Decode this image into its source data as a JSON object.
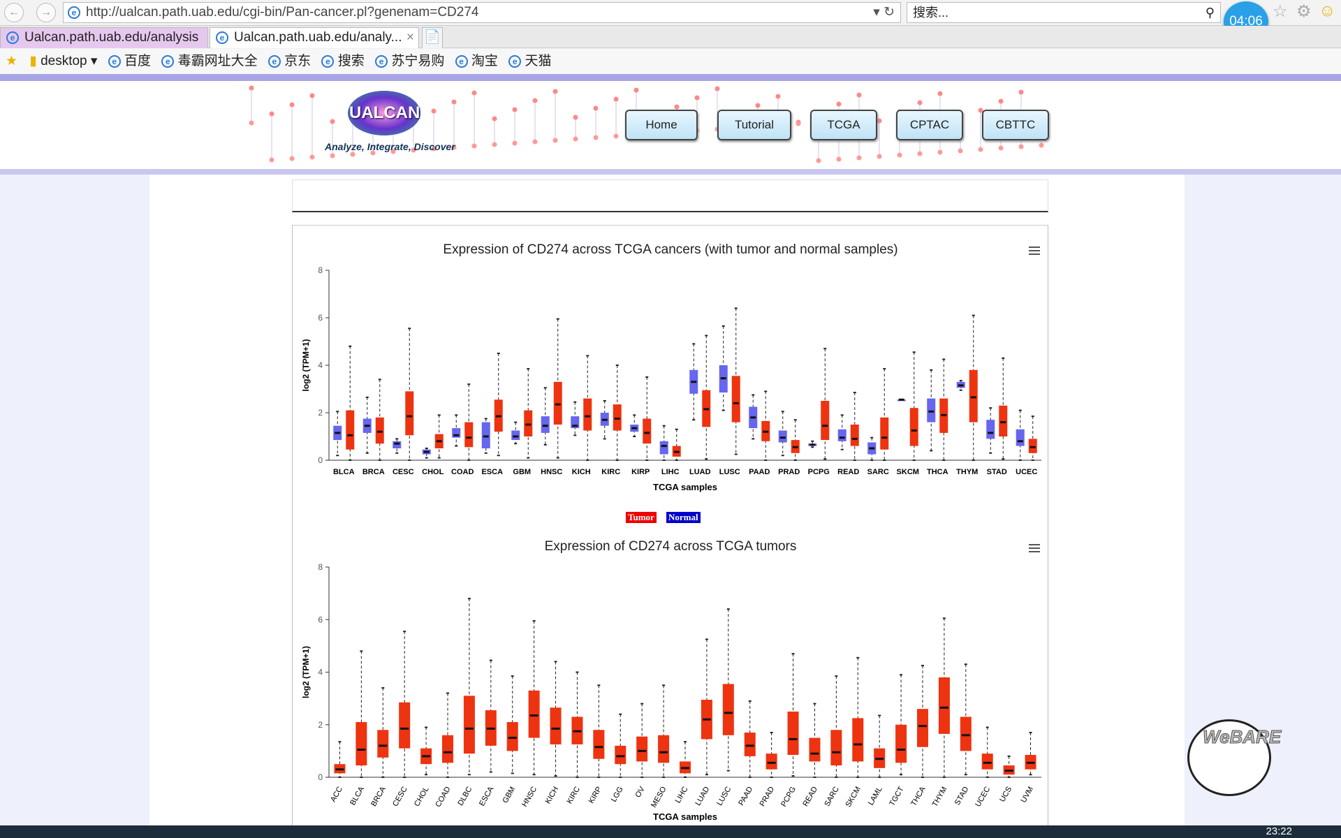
{
  "browser": {
    "url": "http://ualcan.path.uab.edu/cgi-bin/Pan-cancer.pl?genenam=CD274",
    "search_placeholder": "搜索...",
    "clock": "04:06",
    "tabs": [
      {
        "label": "Ualcan.path.uab.edu/analysis"
      },
      {
        "label": "Ualcan.path.uab.edu/analy..."
      }
    ],
    "bookmarks": [
      "desktop",
      "百度",
      "毒霸网址大全",
      "京东",
      "搜索",
      "苏宁易购",
      "淘宝",
      "天猫"
    ],
    "taskbar_time": "23:22"
  },
  "header": {
    "logo": "UALCAN",
    "tagline": "Analyze, Integrate, Discover",
    "nav": [
      "Home",
      "Tutorial",
      "TCGA",
      "CPTAC",
      "CBTTC"
    ]
  },
  "legend": {
    "tumor": "Tumor",
    "normal": "Normal"
  },
  "colors": {
    "tumor": "#ee3311",
    "normal": "#6666ee",
    "accent": "#2aa0e8"
  },
  "chart_data": [
    {
      "type": "box",
      "title": "Expression of CD274 across TCGA cancers (with tumor and normal samples)",
      "xlabel": "TCGA samples",
      "ylabel": "log2 (TPM+1)",
      "ylim": [
        0,
        8
      ],
      "yticks": [
        0,
        2,
        4,
        6,
        8
      ],
      "grid": false,
      "categories": [
        "BLCA",
        "BRCA",
        "CESC",
        "CHOL",
        "COAD",
        "ESCA",
        "GBM",
        "HNSC",
        "KICH",
        "KIRC",
        "KIRP",
        "LIHC",
        "LUAD",
        "LUSC",
        "PAAD",
        "PRAD",
        "PCPG",
        "READ",
        "SARC",
        "SKCM",
        "THCA",
        "THYM",
        "STAD",
        "UCEC"
      ],
      "stat_order": [
        "min",
        "q1",
        "median",
        "q3",
        "max"
      ],
      "series": [
        {
          "name": "Normal",
          "color": "#6666ee",
          "values": [
            [
              0.2,
              0.85,
              1.15,
              1.45,
              2.05
            ],
            [
              0.3,
              1.15,
              1.45,
              1.75,
              2.65
            ],
            [
              0.3,
              0.5,
              0.7,
              0.8,
              0.9
            ],
            [
              0.1,
              0.25,
              0.35,
              0.45,
              0.5
            ],
            [
              0.6,
              0.95,
              1.05,
              1.35,
              1.9
            ],
            [
              0.3,
              0.5,
              1.0,
              1.6,
              1.75
            ],
            [
              0.7,
              0.85,
              1.0,
              1.25,
              1.6
            ],
            [
              0.65,
              1.15,
              1.45,
              1.85,
              3.05
            ],
            [
              1.05,
              1.35,
              1.45,
              1.85,
              2.45
            ],
            [
              0.9,
              1.45,
              1.7,
              2.0,
              2.5
            ],
            [
              1.0,
              1.2,
              1.35,
              1.5,
              1.9
            ],
            [
              0,
              0.25,
              0.6,
              0.8,
              1.45
            ],
            [
              1.7,
              2.8,
              3.3,
              3.8,
              4.9
            ],
            [
              2.1,
              2.85,
              3.45,
              4.0,
              5.65
            ],
            [
              0.9,
              1.35,
              1.8,
              2.25,
              2.75
            ],
            [
              0.2,
              0.75,
              0.95,
              1.25,
              2.05
            ],
            [
              0.55,
              0.6,
              0.65,
              0.7,
              0.8
            ],
            [
              0.45,
              0.8,
              0.95,
              1.3,
              1.9
            ],
            [
              0,
              0.25,
              0.5,
              0.75,
              0.95
            ],
            [
              2.55,
              2.55,
              2.55,
              2.55,
              2.55
            ],
            [
              0.4,
              1.6,
              2.05,
              2.6,
              3.8
            ],
            [
              2.95,
              3.05,
              3.15,
              3.3,
              3.35
            ],
            [
              0.3,
              0.9,
              1.15,
              1.7,
              2.2
            ],
            [
              0,
              0.6,
              0.8,
              1.3,
              2.1
            ]
          ]
        },
        {
          "name": "Tumor",
          "color": "#ee3311",
          "values": [
            [
              0,
              0.45,
              1.05,
              2.1,
              4.8
            ],
            [
              0,
              0.7,
              1.2,
              1.8,
              3.4
            ],
            [
              0,
              1.05,
              1.85,
              2.9,
              5.55
            ],
            [
              0.1,
              0.5,
              0.8,
              1.1,
              1.9
            ],
            [
              0,
              0.55,
              0.95,
              1.6,
              3.2
            ],
            [
              0.2,
              1.2,
              1.85,
              2.55,
              4.5
            ],
            [
              0.1,
              1.0,
              1.5,
              2.1,
              3.85
            ],
            [
              0.1,
              1.5,
              2.35,
              3.3,
              5.95
            ],
            [
              0,
              1.25,
              1.85,
              2.6,
              4.4
            ],
            [
              0,
              1.25,
              1.75,
              2.35,
              4.0
            ],
            [
              0,
              0.7,
              1.15,
              1.75,
              3.5
            ],
            [
              0,
              0.15,
              0.35,
              0.6,
              1.3
            ],
            [
              0.05,
              1.4,
              2.15,
              2.95,
              5.25
            ],
            [
              0.25,
              1.6,
              2.4,
              3.55,
              6.4
            ],
            [
              0,
              0.8,
              1.2,
              1.65,
              2.9
            ],
            [
              0,
              0.3,
              0.55,
              0.85,
              1.7
            ],
            [
              0.05,
              0.85,
              1.45,
              2.5,
              4.7
            ],
            [
              0,
              0.6,
              0.9,
              1.5,
              2.85
            ],
            [
              0,
              0.45,
              0.95,
              1.8,
              3.85
            ],
            [
              0,
              0.6,
              1.25,
              2.2,
              4.55
            ],
            [
              0,
              1.15,
              1.9,
              2.6,
              4.25
            ],
            [
              0,
              1.6,
              2.65,
              3.8,
              6.1
            ],
            [
              0.05,
              1.0,
              1.6,
              2.3,
              4.3
            ],
            [
              0,
              0.3,
              0.55,
              0.9,
              1.85
            ]
          ]
        }
      ]
    },
    {
      "type": "box",
      "title": "Expression of CD274 across TCGA tumors",
      "xlabel": "TCGA samples",
      "ylabel": "log2 (TPM+1)",
      "ylim": [
        0,
        8
      ],
      "yticks": [
        0,
        2,
        4,
        6,
        8
      ],
      "grid": false,
      "categories": [
        "ACC",
        "BLCA",
        "BRCA",
        "CESC",
        "CHOL",
        "COAD",
        "DLBC",
        "ESCA",
        "GBM",
        "HNSC",
        "KICH",
        "KIRC",
        "KIRP",
        "LGG",
        "OV",
        "MESO",
        "LIHC",
        "LUAD",
        "LUSC",
        "PAAD",
        "PRAD",
        "PCPG",
        "READ",
        "SARC",
        "SKCM",
        "LAML",
        "TGCT",
        "THCA",
        "THYM",
        "STAD",
        "UCEC",
        "UCS",
        "UVM"
      ],
      "stat_order": [
        "min",
        "q1",
        "median",
        "q3",
        "max"
      ],
      "series": [
        {
          "name": "Tumor",
          "color": "#ee3311",
          "values": [
            [
              0,
              0.15,
              0.3,
              0.5,
              1.35
            ],
            [
              0,
              0.45,
              1.05,
              2.1,
              4.8
            ],
            [
              0,
              0.75,
              1.2,
              1.8,
              3.4
            ],
            [
              0,
              1.1,
              1.85,
              2.85,
              5.55
            ],
            [
              0.1,
              0.5,
              0.8,
              1.1,
              1.9
            ],
            [
              0,
              0.55,
              0.95,
              1.6,
              3.2
            ],
            [
              0.1,
              0.9,
              1.85,
              3.1,
              6.8
            ],
            [
              0.2,
              1.2,
              1.85,
              2.55,
              4.45
            ],
            [
              0.15,
              1.0,
              1.5,
              2.1,
              3.85
            ],
            [
              0.1,
              1.5,
              2.35,
              3.3,
              5.95
            ],
            [
              0.05,
              1.25,
              1.85,
              2.65,
              4.4
            ],
            [
              0,
              1.25,
              1.75,
              2.3,
              4.0
            ],
            [
              0,
              0.7,
              1.15,
              1.8,
              3.5
            ],
            [
              0,
              0.5,
              0.8,
              1.2,
              2.4
            ],
            [
              0,
              0.6,
              1.0,
              1.55,
              2.8
            ],
            [
              0,
              0.55,
              0.95,
              1.6,
              3.5
            ],
            [
              0,
              0.15,
              0.35,
              0.6,
              1.35
            ],
            [
              0.1,
              1.45,
              2.2,
              2.95,
              5.25
            ],
            [
              0.25,
              1.6,
              2.45,
              3.55,
              6.4
            ],
            [
              0,
              0.8,
              1.2,
              1.7,
              2.9
            ],
            [
              0,
              0.3,
              0.55,
              0.9,
              1.7
            ],
            [
              0.05,
              0.85,
              1.45,
              2.5,
              4.7
            ],
            [
              0,
              0.6,
              0.9,
              1.5,
              2.8
            ],
            [
              0,
              0.45,
              0.95,
              1.8,
              3.85
            ],
            [
              0,
              0.6,
              1.25,
              2.25,
              4.55
            ],
            [
              0,
              0.35,
              0.7,
              1.1,
              2.35
            ],
            [
              0.1,
              0.55,
              1.05,
              2.0,
              3.9
            ],
            [
              0,
              1.15,
              1.95,
              2.6,
              4.25
            ],
            [
              0,
              1.65,
              2.65,
              3.8,
              6.05
            ],
            [
              0.1,
              1.0,
              1.6,
              2.3,
              4.3
            ],
            [
              0,
              0.3,
              0.55,
              0.9,
              1.9
            ],
            [
              0,
              0.1,
              0.25,
              0.45,
              0.8
            ],
            [
              0.1,
              0.3,
              0.55,
              0.85,
              1.7
            ]
          ]
        }
      ]
    }
  ]
}
